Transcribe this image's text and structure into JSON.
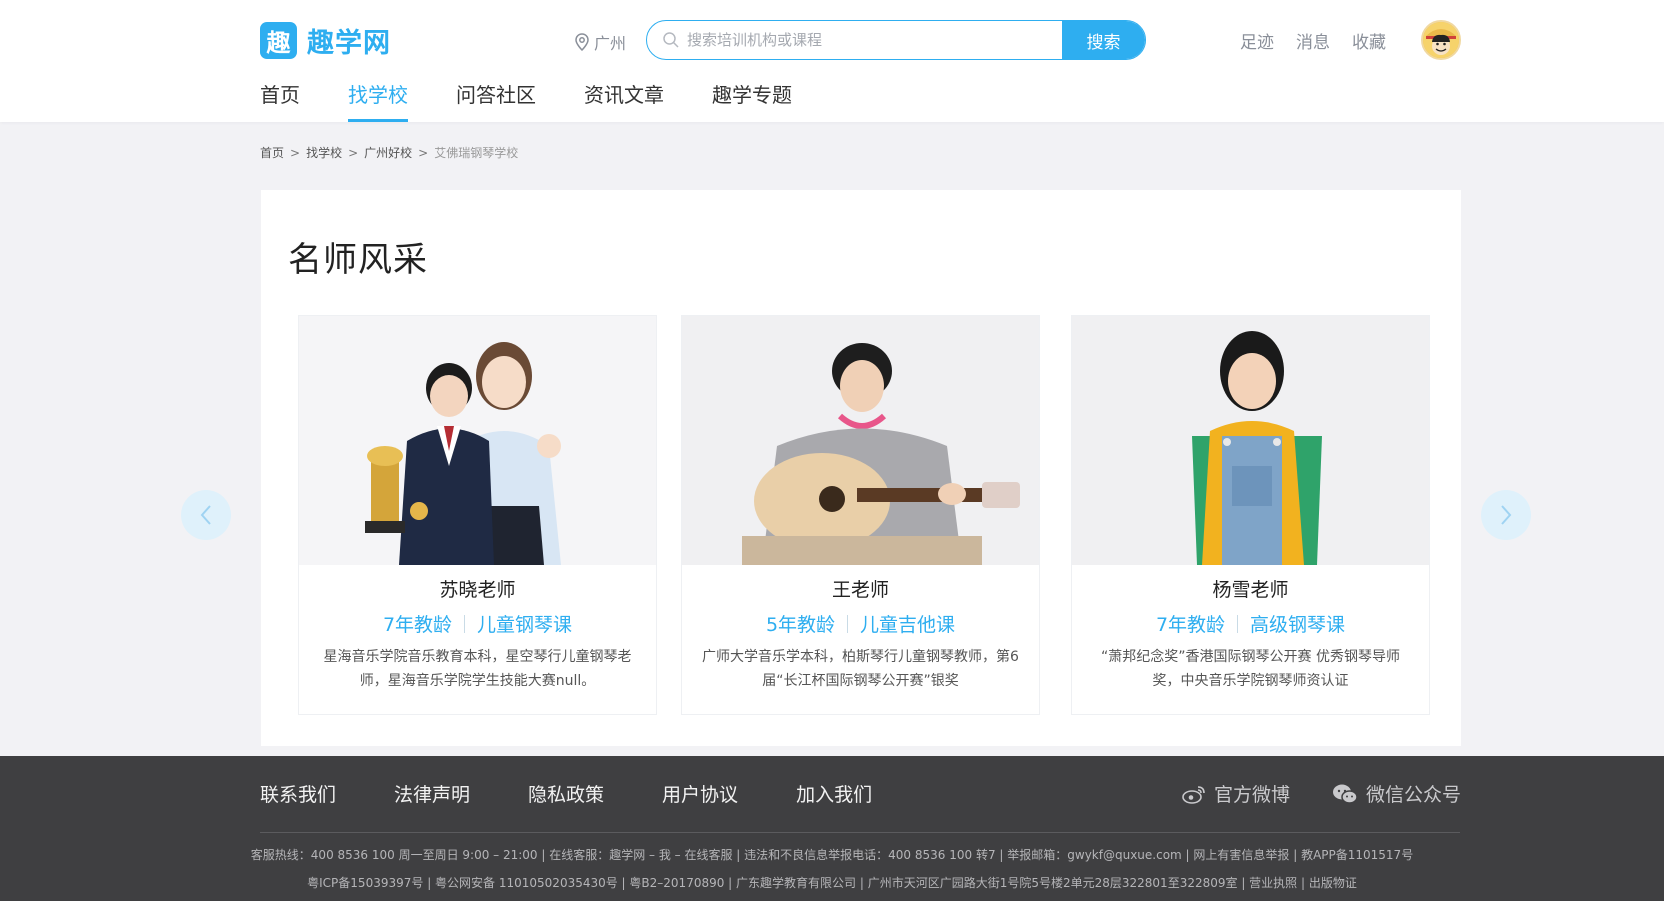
{
  "header": {
    "logo_char": "趣",
    "logo_text": "趣学网",
    "city": "广州",
    "search_placeholder": "搜索培训机构或课程",
    "search_button": "搜索",
    "utils": [
      "足迹",
      "消息",
      "收藏"
    ],
    "nav": [
      "首页",
      "找学校",
      "问答社区",
      "资讯文章",
      "趣学专题"
    ],
    "active_nav": "找学校"
  },
  "breadcrumb": [
    "首页",
    "找学校",
    "广州好校",
    "艾佛瑞钢琴学校"
  ],
  "section_title": "名师风采",
  "teachers": [
    {
      "name": "苏晓老师",
      "years": "7年教龄",
      "course": "儿童钢琴课",
      "desc": "星海音乐学院音乐教育本科，星空琴行儿童钢琴老师，星海音乐学院学生技能大赛null。"
    },
    {
      "name": "王老师",
      "years": "5年教龄",
      "course": "儿童吉他课",
      "desc": "广师大学音乐学本科，柏斯琴行儿童钢琴教师，第6届“长江杯国际钢琴公开赛”银奖"
    },
    {
      "name": "杨雪老师",
      "years": "7年教龄",
      "course": "高级钢琴课",
      "desc": "“萧邦纪念奖”香港国际钢琴公开赛 优秀钢琴导师奖，中央音乐学院钢琴师资认证"
    }
  ],
  "footer": {
    "links": [
      "联系我们",
      "法律声明",
      "隐私政策",
      "用户协议",
      "加入我们"
    ],
    "weibo": "官方微博",
    "wechat": "微信公众号",
    "info_line1": "客服热线：400 8536 100 周一至周日 9:00 – 21:00  |  在线客服：趣学网 – 我 – 在线客服  |  违法和不良信息举报电话：400 8536 100 转7  |  举报邮箱：gwykf@quxue.com  |  网上有害信息举报  |  教APP备1101517号",
    "info_line2": "粤ICP备15039397号  |  粤公网安备 11010502035430号  |  粤B2–20170890  |  广东趣学教育有限公司  |  广州市天河区广园路大街1号院5号楼2单元28层322801至322809室  |  营业执照  |  出版物证"
  },
  "colors": {
    "accent": "#2eaef0",
    "footer_bg": "#3f3f41",
    "page_bg": "#f2f2f5"
  }
}
